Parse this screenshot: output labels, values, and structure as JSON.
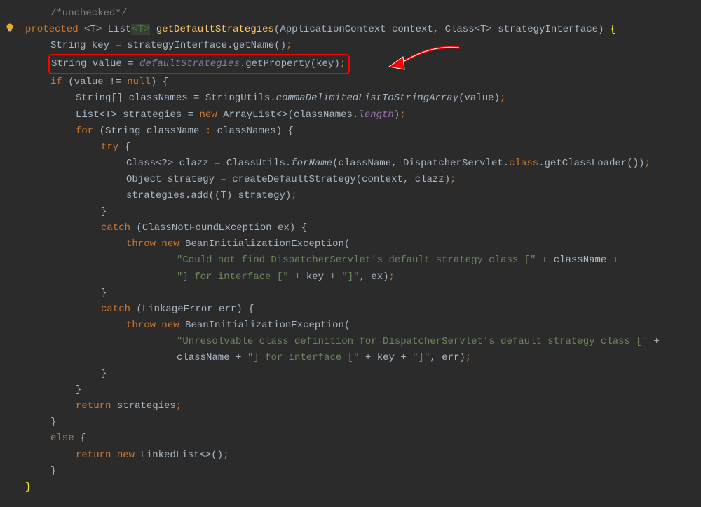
{
  "comment": "/*unchecked*/",
  "l2": {
    "kw_protected": "protected",
    "lt": "<",
    "T1": "T",
    "gt": ">",
    "sp": " ",
    "List": "List",
    "lt2": "<",
    "T2": "T",
    "gt2": ">",
    "method": "getDefaultStrategies",
    "lp": "(",
    "ptype1": "ApplicationContext ",
    "pname1": "context",
    "comma": ", ",
    "ptype2": "Class",
    "lt3": "<",
    "T3": "T",
    "gt3": ">",
    "sp2": " ",
    "pname2": "strategyInterface",
    "rp": ")",
    "sp3": " ",
    "brace": "{"
  },
  "l3": {
    "t1": "String key ",
    "eq": "=",
    "t2": " strategyInterface",
    "dot": ".",
    "m": "getName",
    "p": "()",
    "semi": ";"
  },
  "l4": {
    "t1": "String value ",
    "eq": "=",
    "sp": " ",
    "field": "defaultStrategies",
    "dot": ".",
    "m": "getProperty",
    "lp": "(",
    "arg": "key",
    "rp": ")",
    "semi": ";"
  },
  "l5": {
    "kw_if": "if",
    "sp": " ",
    "lp": "(",
    "v": "value ",
    "neq": "!=",
    "n": " null",
    "rp": ")",
    "sp2": " ",
    "brace": "{"
  },
  "l6": {
    "t1": "String[] classNames ",
    "eq": "=",
    "t2": " StringUtils",
    "dot": ".",
    "m": "commaDelimitedListToStringArray",
    "lp": "(",
    "arg": "value",
    "rp": ")",
    "semi": ";"
  },
  "l7": {
    "t1": "List",
    "lt": "<",
    "T": "T",
    "gt": ">",
    "t2": " strategies ",
    "eq": "=",
    "sp": " ",
    "kw_new": "new",
    "sp2": " ",
    "cls": "ArrayList",
    "diamond": "<>",
    "lp": "(",
    "arg": "classNames",
    "dot": ".",
    "fld": "length",
    "rp": ")",
    "semi": ";"
  },
  "l8": {
    "kw_for": "for",
    "sp": " ",
    "lp": "(",
    "t": "String className ",
    "colon": ":",
    "t2": " classNames",
    "rp": ")",
    "sp2": " ",
    "brace": "{"
  },
  "l9": {
    "kw_try": "try",
    "sp": " ",
    "brace": "{"
  },
  "l10": {
    "t1": "Class",
    "lt": "<",
    "q": "?",
    "gt": ">",
    "t2": " clazz ",
    "eq": "=",
    "t3": " ClassUtils",
    "dot": ".",
    "m": "forName",
    "lp": "(",
    "a1": "className",
    "c1": ", ",
    "a2": "DispatcherServlet",
    "dot2": ".",
    "cls": "class",
    "dot3": ".",
    "m2": "getClassLoader",
    "p2": "()",
    "rp": ")",
    "semi": ";"
  },
  "l11": {
    "t1": "Object strategy ",
    "eq": "=",
    "t2": " createDefaultStrategy",
    "lp": "(",
    "a1": "context",
    "c": ", ",
    "a2": "clazz",
    "rp": ")",
    "semi": ";"
  },
  "l12": {
    "t1": "strategies",
    "dot": ".",
    "m": "add",
    "lp": "(",
    "cast_lp": "(",
    "T": "T",
    "cast_rp": ")",
    "sp": " ",
    "a": "strategy",
    "rp": ")",
    "semi": ";"
  },
  "l13": {
    "brace": "}"
  },
  "l14": {
    "kw_catch": "catch",
    "sp": " ",
    "lp": "(",
    "t": "ClassNotFoundException ex",
    "rp": ")",
    "sp2": " ",
    "brace": "{"
  },
  "l15": {
    "kw_throw": "throw",
    "sp": " ",
    "kw_new": "new",
    "sp2": " ",
    "cls": "BeanInitializationException",
    "lp": "("
  },
  "l16": {
    "s1": "\"Could not find DispatcherServlet's default strategy class [\"",
    "sp1": " ",
    "plus1": "+",
    "sp2": " ",
    "v": "className",
    "sp3": " ",
    "plus2": "+"
  },
  "l17": {
    "s1": "\"] for interface [\"",
    "sp1": " ",
    "plus1": "+",
    "sp2": " ",
    "v1": "key",
    "sp3": " ",
    "plus2": "+",
    "sp4": " ",
    "s2": "\"]\"",
    "c": ", ",
    "v2": "ex",
    "rp": ")",
    "semi": ";"
  },
  "l18": {
    "brace": "}"
  },
  "l19": {
    "kw_catch": "catch",
    "sp": " ",
    "lp": "(",
    "t": "LinkageError err",
    "rp": ")",
    "sp2": " ",
    "brace": "{"
  },
  "l20": {
    "kw_throw": "throw",
    "sp": " ",
    "kw_new": "new",
    "sp2": " ",
    "cls": "BeanInitializationException",
    "lp": "("
  },
  "l21": {
    "s1": "\"Unresolvable class definition for DispatcherServlet's default strategy class [\"",
    "sp1": " ",
    "plus1": "+"
  },
  "l22": {
    "v1": "className",
    "sp1": " ",
    "plus1": "+",
    "sp2": " ",
    "s1": "\"] for interface [\"",
    "sp3": " ",
    "plus2": "+",
    "sp4": " ",
    "v2": "key",
    "sp5": " ",
    "plus3": "+",
    "sp6": " ",
    "s2": "\"]\"",
    "c": ", ",
    "v3": "err",
    "rp": ")",
    "semi": ";"
  },
  "l23": {
    "brace": "}"
  },
  "l24": {
    "brace": "}"
  },
  "l25": {
    "kw_return": "return",
    "sp": " ",
    "v": "strategies",
    "semi": ";"
  },
  "l26": {
    "brace": "}"
  },
  "l27": {
    "kw_else": "else",
    "sp": " ",
    "brace": "{"
  },
  "l28": {
    "kw_return": "return",
    "sp": " ",
    "kw_new": "new",
    "sp2": " ",
    "cls": "LinkedList",
    "diamond": "<>",
    "p": "()",
    "semi": ";"
  },
  "l29": {
    "brace": "}"
  },
  "l30": {
    "brace": "}"
  }
}
